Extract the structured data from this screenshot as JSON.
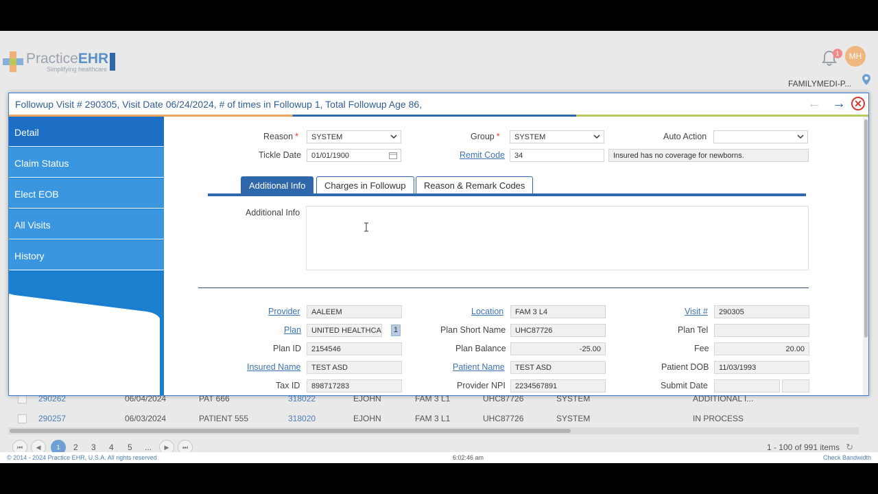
{
  "brand": {
    "logo_main": "Practice",
    "logo_bold": "EHR",
    "tagline": "Simplifying healthcare"
  },
  "header": {
    "notification_count": "1",
    "avatar_initials": "MH",
    "practice_name": "FAMILYMEDI-P..."
  },
  "colors": {
    "primary": "#2f67ad",
    "sidebar": "#3b96e0",
    "sidebar_active": "#1c6fc4",
    "close": "#d9352c",
    "link": "#3b73b4"
  },
  "modal": {
    "title": "Followup Visit # 290305, Visit Date 06/24/2024, # of times in Followup 1, Total Followup Age 86,",
    "back_arrow": "←",
    "forward_arrow": "→",
    "close": "✕"
  },
  "sidebar": {
    "items": [
      {
        "label": "Detail"
      },
      {
        "label": "Claim Status"
      },
      {
        "label": "Elect EOB"
      },
      {
        "label": "All Visits"
      },
      {
        "label": "History"
      }
    ]
  },
  "form": {
    "reason_label": "Reason",
    "reason_value": "SYSTEM",
    "group_label": "Group",
    "group_value": "SYSTEM",
    "auto_action_label": "Auto Action",
    "auto_action_value": "",
    "tickle_date_label": "Tickle Date",
    "tickle_date_value": "01/01/1900",
    "remit_code_label": "Remit Code",
    "remit_code_value": "34",
    "remit_desc": "Insured has no coverage for newborns.",
    "required_mark": "*"
  },
  "tabs": [
    {
      "label": "Additional Info"
    },
    {
      "label": "Charges in Followup"
    },
    {
      "label": "Reason & Remark Codes"
    }
  ],
  "additional_info": {
    "label": "Additional Info",
    "value": ""
  },
  "details": {
    "provider_label": "Provider",
    "provider_value": "AALEEM",
    "location_label": "Location",
    "location_value": "FAM 3 L4",
    "visit_label": "Visit #",
    "visit_value": "290305",
    "plan_label": "Plan",
    "plan_value": "UNITED HEALTHCAI",
    "plan_badge": "1",
    "plan_short_label": "Plan Short Name",
    "plan_short_value": "UHC87726",
    "plan_tel_label": "Plan Tel",
    "plan_tel_value": "",
    "plan_id_label": "Plan ID",
    "plan_id_value": "2154546",
    "plan_balance_label": "Plan Balance",
    "plan_balance_value": "-25.00",
    "fee_label": "Fee",
    "fee_value": "20.00",
    "insured_label": "Insured Name",
    "insured_value": "TEST ASD",
    "patient_label": "Patient Name",
    "patient_value": "TEST ASD",
    "dob_label": "Patient DOB",
    "dob_value": "11/03/1993",
    "tax_label": "Tax ID",
    "tax_value": "898717283",
    "npi_label": "Provider NPI",
    "npi_value": "2234567891",
    "submit_label": "Submit Date",
    "submit_value": ""
  },
  "grid_rows": [
    {
      "visit": "290262",
      "date": "06/04/2024",
      "patient": "PAT 666",
      "acct": "318022",
      "provider": "EJOHN",
      "location": "FAM 3 L1",
      "plan": "UHC87726",
      "reason": "SYSTEM",
      "status": "ADDITIONAL I..."
    },
    {
      "visit": "290257",
      "date": "06/03/2024",
      "patient": "PATIENT 555",
      "acct": "318020",
      "provider": "EJOHN",
      "location": "FAM 3 L1",
      "plan": "UHC87726",
      "reason": "SYSTEM",
      "status": "IN PROCESS"
    }
  ],
  "pager": {
    "first": "⏮",
    "prev": "◀",
    "next": "▶",
    "last": "⏭",
    "pages": [
      "1",
      "2",
      "3",
      "4",
      "5",
      "..."
    ],
    "info": "1 - 100 of 991 items",
    "refresh": "↻"
  },
  "footer": {
    "copyright": "© 2014 - 2024 Practice EHR, U.S.A. All rights reserved",
    "time": "6:02:46 am",
    "bandwidth": "Check Bandwidth"
  }
}
